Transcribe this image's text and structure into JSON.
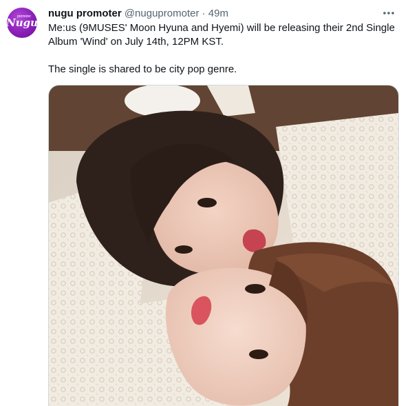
{
  "tweet": {
    "author": {
      "display_name": "nugu promoter",
      "handle": "@nugupromoter",
      "avatar_icon": "nugu-promoter-logo",
      "avatar_logo_text": "Nugu",
      "avatar_logo_subtext": "promoter"
    },
    "separator": "·",
    "timestamp": "49m",
    "more_icon": "more-horizontal-icon",
    "body": {
      "line1": "Me:us (9MUSES' Moon Hyuna and Hyemi) will be releasing their 2nd Single Album 'Wind' on July 14th, 12PM KST.",
      "line2": "The single is shared to be city pop genre."
    },
    "media": {
      "kind": "photo",
      "subject": "two-women-lying-on-lace"
    }
  },
  "colors": {
    "text_primary": "#0f1419",
    "text_secondary": "#536471",
    "border": "#cfd9de",
    "avatar_purple": "#8a1fb8"
  }
}
